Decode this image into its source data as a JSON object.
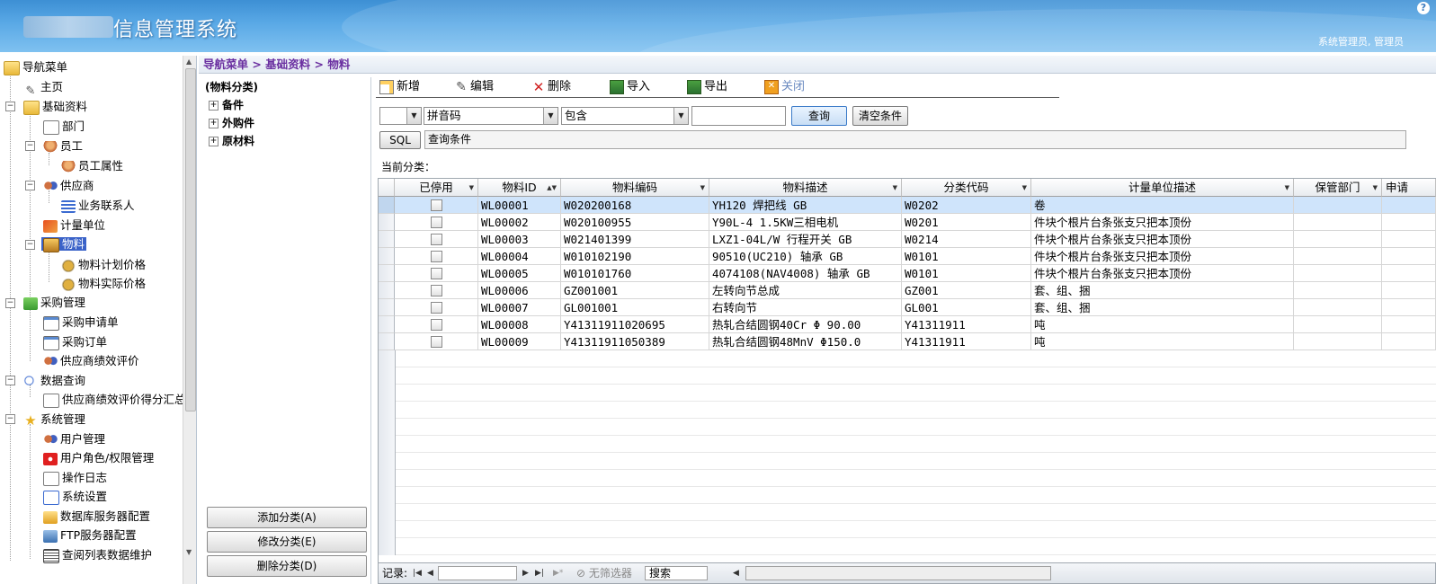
{
  "header": {
    "title": "信息管理系统",
    "help": "?",
    "user": "系统管理员, 管理员"
  },
  "nav": {
    "items": [
      {
        "label": "导航菜单",
        "icon": "folder-open-icon"
      },
      {
        "label": "主页",
        "icon": "pen-icon"
      },
      {
        "label": "基础资料",
        "icon": "folder-open-icon"
      },
      {
        "label": "部门",
        "icon": "document-icon"
      },
      {
        "label": "员工",
        "icon": "user-icon"
      },
      {
        "label": "员工属性",
        "icon": "user-edit-icon"
      },
      {
        "label": "供应商",
        "icon": "users-icon"
      },
      {
        "label": "业务联系人",
        "icon": "list-icon"
      },
      {
        "label": "计量单位",
        "icon": "unit-icon"
      },
      {
        "label": "物料",
        "icon": "box-icon"
      },
      {
        "label": "物料计划价格",
        "icon": "money-bag-icon"
      },
      {
        "label": "物料实际价格",
        "icon": "money-bag-icon"
      },
      {
        "label": "采购管理",
        "icon": "basket-icon"
      },
      {
        "label": "采购申请单",
        "icon": "form-icon"
      },
      {
        "label": "采购订单",
        "icon": "form-icon"
      },
      {
        "label": "供应商绩效评价",
        "icon": "user-card-icon"
      },
      {
        "label": "数据查询",
        "icon": "search-icon"
      },
      {
        "label": "供应商绩效评价得分汇总",
        "icon": "document-icon"
      },
      {
        "label": "系统管理",
        "icon": "star-icon"
      },
      {
        "label": "用户管理",
        "icon": "users-icon"
      },
      {
        "label": "用户角色/权限管理",
        "icon": "stop-icon"
      },
      {
        "label": "操作日志",
        "icon": "document-icon"
      },
      {
        "label": "系统设置",
        "icon": "settings-doc-icon"
      },
      {
        "label": "数据库服务器配置",
        "icon": "database-icon"
      },
      {
        "label": "FTP服务器配置",
        "icon": "ftp-icon"
      },
      {
        "label": "查阅列表数据维护",
        "icon": "table-icon"
      }
    ]
  },
  "breadcrumb": "导航菜单 > 基础资料 > 物料",
  "category": {
    "title": "(物料分类)",
    "items": [
      "备件",
      "外购件",
      "原材料"
    ],
    "buttons": [
      "添加分类(A)",
      "修改分类(E)",
      "删除分类(D)"
    ]
  },
  "toolbar": {
    "new": "新增",
    "edit": "编辑",
    "delete": "删除",
    "import": "导入",
    "export": "导出",
    "close": "关闭"
  },
  "filter": {
    "first_value": "",
    "field": "拼音码",
    "op": "包含",
    "value": "",
    "query_btn": "查询",
    "clear_btn": "清空条件",
    "sql_btn": "SQL",
    "sql_text": "查询条件"
  },
  "current_category": "当前分类：",
  "grid": {
    "columns": [
      "已停用",
      "物料ID",
      "物料编码",
      "物料描述",
      "分类代码",
      "计量单位描述",
      "保管部门",
      "申请"
    ],
    "rows": [
      {
        "id": "WL00001",
        "code": "W020200168",
        "desc": "YH120 焊把线 GB",
        "cat": "W0202",
        "unit": "卷",
        "dept": ""
      },
      {
        "id": "WL00002",
        "code": "W020100955",
        "desc": "Y90L-4   1.5KW三相电机",
        "cat": "W0201",
        "unit": "件块个根片台条张支只把本顶份",
        "dept": ""
      },
      {
        "id": "WL00003",
        "code": "W021401399",
        "desc": "LXZ1-04L/W 行程开关 GB",
        "cat": "W0214",
        "unit": "件块个根片台条张支只把本顶份",
        "dept": ""
      },
      {
        "id": "WL00004",
        "code": "W010102190",
        "desc": "90510(UC210) 轴承 GB",
        "cat": "W0101",
        "unit": "件块个根片台条张支只把本顶份",
        "dept": ""
      },
      {
        "id": "WL00005",
        "code": "W010101760",
        "desc": "4074108(NAV4008) 轴承 GB",
        "cat": "W0101",
        "unit": "件块个根片台条张支只把本顶份",
        "dept": ""
      },
      {
        "id": "WL00006",
        "code": "GZ001001",
        "desc": "左转向节总成",
        "cat": "GZ001",
        "unit": "套、组、捆",
        "dept": ""
      },
      {
        "id": "WL00007",
        "code": "GL001001",
        "desc": "右转向节",
        "cat": "GL001",
        "unit": "套、组、捆",
        "dept": ""
      },
      {
        "id": "WL00008",
        "code": "Y41311911020695",
        "desc": "热轧合结圆钢40Cr Φ 90.00",
        "cat": "Y41311911",
        "unit": "吨",
        "dept": ""
      },
      {
        "id": "WL00009",
        "code": "Y41311911050389",
        "desc": "热轧合结圆钢48MnV Φ150.0",
        "cat": "Y41311911",
        "unit": "吨",
        "dept": ""
      }
    ]
  },
  "status": {
    "records_label": "记录:",
    "no_filter": "无筛选器",
    "search": "搜索"
  }
}
